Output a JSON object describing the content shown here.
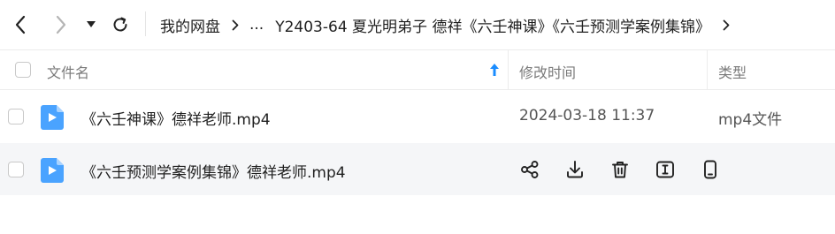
{
  "navbar": {
    "back_icon": "chevron-left-icon",
    "forward_icon": "chevron-right-icon",
    "dropdown_icon": "caret-down-icon",
    "refresh_icon": "refresh-icon"
  },
  "breadcrumb": {
    "root": "我的网盘",
    "ellipsis": "...",
    "current": "Y2403-64 夏光明弟子 德祥《六壬神课》《六壬预测学案例集锦》"
  },
  "table": {
    "headers": {
      "name": "文件名",
      "modified": "修改时间",
      "type": "类型"
    },
    "sort": {
      "column": "name",
      "direction": "ascending"
    },
    "rows": [
      {
        "name": "《六壬神课》德祥老师.mp4",
        "modified": "2024-03-18 11:37",
        "type": "mp4文件",
        "icon": "video-file-icon"
      },
      {
        "name": "《六壬预测学案例集锦》德祥老师.mp4",
        "modified": "",
        "type": "",
        "icon": "video-file-icon",
        "actions": [
          "share-icon",
          "download-icon",
          "delete-icon",
          "rename-icon",
          "mobile-icon"
        ]
      }
    ]
  },
  "colors": {
    "accent": "#1a8cff",
    "file_icon": "#4aa3ff",
    "hover_row": "#f5f6f8"
  }
}
